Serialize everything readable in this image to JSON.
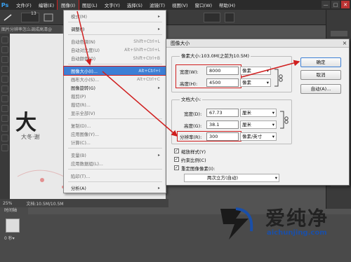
{
  "app": {
    "logo": "Ps"
  },
  "menubar": {
    "items": [
      "文件(F)",
      "编辑(E)",
      "图像(I)",
      "图层(L)",
      "文字(Y)",
      "选择(S)",
      "滤镜(T)",
      "视图(V)",
      "窗口(W)",
      "帮助(H)"
    ],
    "active_index": 2,
    "window_buttons": [
      "—",
      "□",
      "✕"
    ]
  },
  "options_bar": {
    "brush_size": "13"
  },
  "document": {
    "tab_title": "图片分辨率怎么调成高清@"
  },
  "status_bar": {
    "zoom": "25%",
    "doc_info": "文档:10.5M/10.5M"
  },
  "timeline": {
    "tab_label": "时间轴",
    "frame_label": "0 秒▾"
  },
  "image_menu": {
    "items": [
      {
        "label": "模式(M)",
        "submenu": true
      },
      {
        "label": "调整(J)",
        "submenu": true
      },
      {
        "label": "自动色调(N)",
        "shortcut": "Shift+Ctrl+L"
      },
      {
        "label": "自动对比度(U)",
        "shortcut": "Alt+Shift+Ctrl+L"
      },
      {
        "label": "自动颜色(O)",
        "shortcut": "Shift+Ctrl+B"
      },
      {
        "label": "图像大小(I)...",
        "shortcut": "Alt+Ctrl+I"
      },
      {
        "label": "画布大小(S)...",
        "shortcut": "Alt+Ctrl+C"
      },
      {
        "label": "图像旋转(G)",
        "submenu": true
      },
      {
        "label": "裁剪(P)"
      },
      {
        "label": "裁切(R)..."
      },
      {
        "label": "显示全部(V)"
      },
      {
        "label": "复制(D)..."
      },
      {
        "label": "应用图像(Y)..."
      },
      {
        "label": "计算(C)..."
      },
      {
        "label": "变量(B)",
        "submenu": true
      },
      {
        "label": "应用数据组(L)..."
      },
      {
        "label": "陷印(T)..."
      },
      {
        "label": "分析(A)",
        "submenu": true
      }
    ],
    "highlighted_index": 5
  },
  "dialog": {
    "title": "图像大小",
    "close_icon": "×",
    "pixel_dimensions_label": "像素大小:103.0M(之前为10.5M)",
    "width_label": "宽度(W):",
    "width_value": "8000",
    "width_unit": "像素",
    "height_label": "高度(H):",
    "height_value": "4500",
    "height_unit": "像素",
    "document_size_label": "文档大小:",
    "doc_width_label": "宽度(D):",
    "doc_width_value": "67.73",
    "doc_width_unit": "厘米",
    "doc_height_label": "高度(G):",
    "doc_height_value": "38.1",
    "doc_height_unit": "厘米",
    "resolution_label": "分辨率(R):",
    "resolution_value": "300",
    "resolution_unit": "像素/英寸",
    "scale_styles_label": "缩放样式(Y)",
    "constrain_label": "约束比例(C)",
    "resample_label": "重定图像像素(I):",
    "resample_method": "两次立方(自动)",
    "ok_label": "确定",
    "cancel_label": "取消",
    "auto_label": "自动(A)..."
  },
  "watermark": {
    "brand": "爱纯净",
    "url": "aichunjing.com"
  },
  "canvas_text": {
    "title": "大",
    "sub": "大冬·谢"
  },
  "colors": {
    "accent": "#3d7fd5",
    "annotation_red": "#d01f1f"
  }
}
